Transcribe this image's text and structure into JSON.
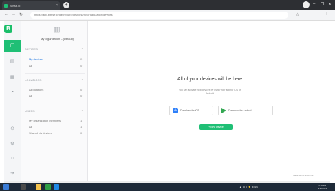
{
  "browser": {
    "tab_title": "Bitrise.io",
    "tab_close": "×",
    "new_tab": "+",
    "address": "https://app.bitrise.io/dashboard/devices/my-organization/devices",
    "nav": {
      "back": "←",
      "forward": "→",
      "reload": "↻"
    },
    "ext_icons": [
      "☆",
      "⋮"
    ],
    "window_controls": [
      "–",
      "❐",
      "✕"
    ]
  },
  "rail": {
    "logo": "B",
    "icons": [
      "home-icon",
      "devices-icon",
      "groups-icon",
      "apps-icon",
      "bell-icon",
      "settings-icon",
      "help-icon",
      "logout-icon"
    ]
  },
  "sidebar": {
    "org_name": "My organization – (Default)",
    "sections": [
      {
        "title": "DEVICES",
        "chevron": "⌃",
        "items": [
          {
            "label": "My devices",
            "count": "0"
          },
          {
            "label": "All",
            "count": "0"
          }
        ]
      },
      {
        "title": "LOCATIONS",
        "chevron": "⌃",
        "items": [
          {
            "label": "All locations",
            "count": "0"
          },
          {
            "label": "All",
            "count": "0"
          }
        ]
      },
      {
        "title": "USERS",
        "chevron": "⌃",
        "items": [
          {
            "label": "My organization members",
            "count": "1"
          },
          {
            "label": "All",
            "count": "1"
          },
          {
            "label": "Shared via devices",
            "count": "0"
          }
        ]
      }
    ]
  },
  "main": {
    "empty_title": "All of your devices will be here",
    "empty_subtitle": "You can activate new devices by using your app for iOS or Android",
    "ios_button": "Download for iOS",
    "android_button": "Download for Android",
    "new_device_button": "+ New Device",
    "footer_note": "Made with ❤ in Bitrise"
  },
  "taskbar": {
    "tray_text": "▲ ⊞ ♪ ⚡ ENG",
    "time": "4:15 PM",
    "date": "8/30/2021"
  }
}
